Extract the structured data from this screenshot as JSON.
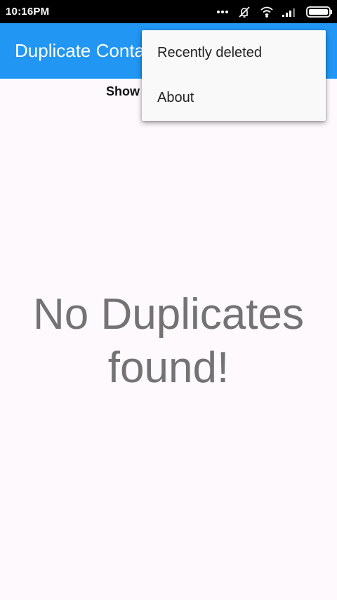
{
  "status_bar": {
    "time": "10:16PM",
    "icons": [
      "more-dots-icon",
      "vibrate-off-icon",
      "wifi-icon",
      "signal-icon",
      "battery-icon"
    ]
  },
  "app_bar": {
    "title": "Duplicate Conta",
    "color": "#2196f3"
  },
  "toolbar": {
    "show_label": "Show"
  },
  "menu": {
    "items": [
      {
        "label": "Recently deleted"
      },
      {
        "label": "About"
      }
    ]
  },
  "empty_state": {
    "line1": "No Duplicates",
    "line2": "found!"
  }
}
